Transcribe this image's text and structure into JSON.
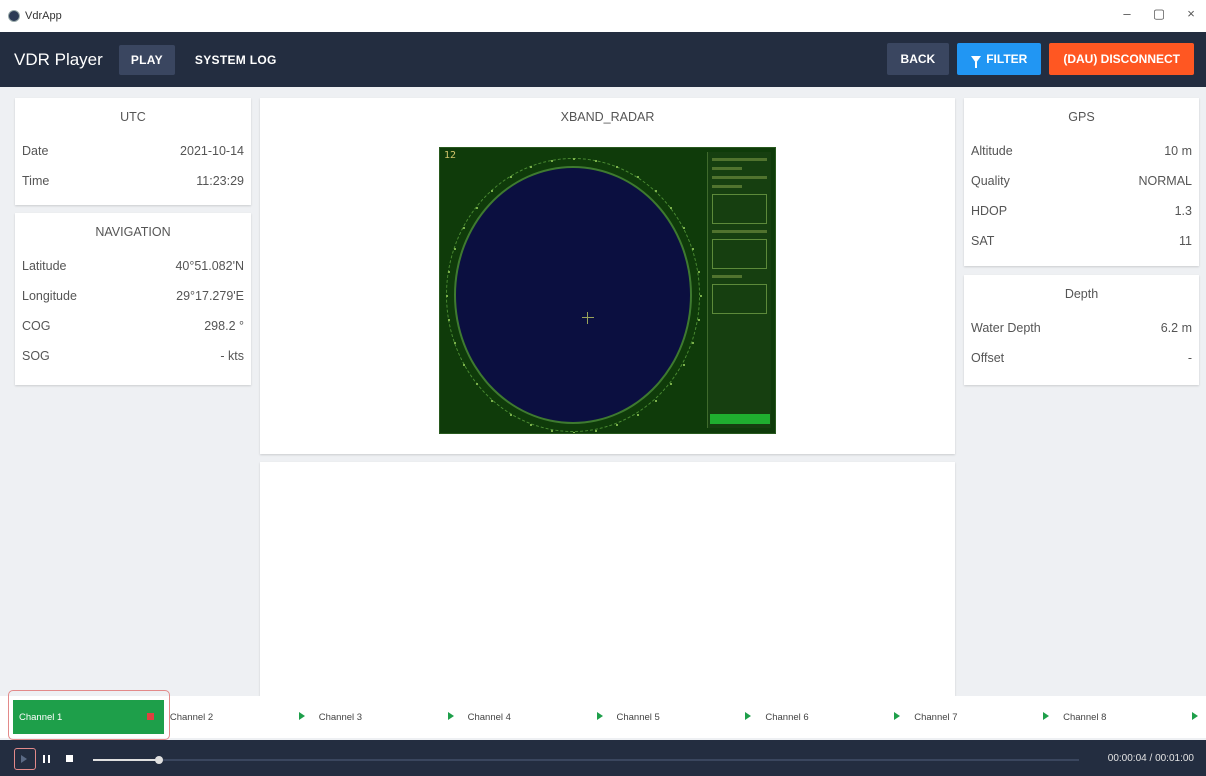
{
  "window": {
    "title": "VdrApp",
    "controls": [
      "–",
      "▢",
      "×"
    ]
  },
  "header": {
    "app_name": "VDR Player",
    "nav": [
      {
        "label": "PLAY",
        "active": true
      },
      {
        "label": "SYSTEM LOG",
        "active": false
      }
    ],
    "back_label": "BACK",
    "filter_label": "FILTER",
    "disconnect_label": "(DAU) DISCONNECT",
    "colors": {
      "bar": "#232d40",
      "filter": "#2196f3",
      "disconnect": "#ff5722"
    }
  },
  "utc": {
    "title": "UTC",
    "rows": [
      {
        "label": "Date",
        "value": "2021-10-14"
      },
      {
        "label": "Time",
        "value": "11:23:29"
      }
    ]
  },
  "navigation": {
    "title": "NAVIGATION",
    "rows": [
      {
        "label": "Latitude",
        "value": "40°51.082'N"
      },
      {
        "label": "Longitude",
        "value": "29°17.279'E"
      },
      {
        "label": "COG",
        "value": "298.2 °"
      },
      {
        "label": "SOG",
        "value": "- kts"
      }
    ]
  },
  "radar": {
    "title": "XBAND_RADAR",
    "range_label": "12"
  },
  "gps": {
    "title": "GPS",
    "rows": [
      {
        "label": "Altitude",
        "value": "10 m"
      },
      {
        "label": "Quality",
        "value": "NORMAL"
      },
      {
        "label": "HDOP",
        "value": "1.3"
      },
      {
        "label": "SAT",
        "value": "11"
      }
    ]
  },
  "depth": {
    "title": "Depth",
    "rows": [
      {
        "label": "Water Depth",
        "value": "6.2 m"
      },
      {
        "label": "Offset",
        "value": "-"
      }
    ]
  },
  "channels": [
    {
      "label": "Channel 1",
      "state": "playing"
    },
    {
      "label": "Channel 2",
      "state": "paused"
    },
    {
      "label": "Channel 3",
      "state": "paused"
    },
    {
      "label": "Channel 4",
      "state": "paused"
    },
    {
      "label": "Channel 5",
      "state": "paused"
    },
    {
      "label": "Channel 6",
      "state": "paused"
    },
    {
      "label": "Channel 7",
      "state": "paused"
    },
    {
      "label": "Channel 8",
      "state": "paused"
    }
  ],
  "player": {
    "current_time": "00:00:04",
    "separator": "/",
    "total_time": "00:01:00",
    "progress": 0.067
  }
}
